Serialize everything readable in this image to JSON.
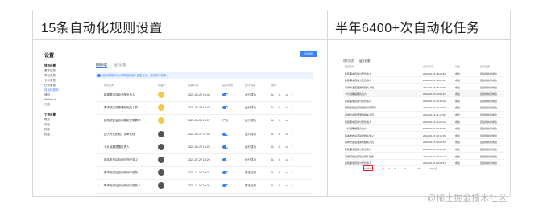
{
  "panels": [
    {
      "title": "15条自动化规则设置"
    },
    {
      "title": "半年6400+次自动化任务"
    }
  ],
  "settings": {
    "title": "设置",
    "create_button": "添加规则",
    "sidebar_groups": [
      {
        "label": "项目设置",
        "items": [
          "基本信息",
          "项目成员",
          "卡片类型",
          "任务看板",
          "自动化规则",
          "通知",
          "Webhook",
          "归档"
        ]
      },
      {
        "label": "工作设置",
        "items": [
          "概览",
          "字段",
          "标签",
          "权限"
        ]
      }
    ],
    "tabs": [
      "规则列表",
      "运行记录"
    ],
    "banner": "自动化规则可以帮助团队减少重复工作，提升协作效率。",
    "columns": [
      "规则名称",
      "创建人",
      "更新时间",
      "启用状态",
      "运行结果",
      "操作"
    ],
    "rules": [
      {
        "name": "新建需求自动分配负责人",
        "time": "2021-05-25 15:46",
        "enabled": true,
        "tag": "运行成功",
        "icon_color": "#f2c94c"
      },
      {
        "name": "需求状态变更通知相关人员",
        "time": "2021-05-25 15:46",
        "enabled": true,
        "tag": "运行成功",
        "icon_color": "#f2c94c"
      },
      {
        "name": "缺陷修复后自动更新关联需求",
        "time": "2021-05-31 16:07",
        "enabled": false,
        "tag": "运行成功",
        "icon_color": "#f2c94c"
      },
      {
        "name": "进入开发阶段，评审完成",
        "time": "2021-06-17 17:42",
        "enabled": true,
        "tag": "运行成功",
        "icon_color": "#555555"
      },
      {
        "name": "卡片延期提醒负责人",
        "time": "2021-06-22 15:28",
        "enabled": true,
        "tag": "运行成功",
        "icon_color": "#555555"
      },
      {
        "name": "版本发布后自动归档任务-2",
        "time": "2021-07-22 13:20",
        "enabled": true,
        "tag": "运行成功",
        "icon_color": "#555555"
      },
      {
        "name": "需求完成后自动关闭子任务",
        "time": "2021-11-29 10:07",
        "enabled": true,
        "tag": "暂无记录",
        "icon_color": "#555555"
      },
      {
        "name": "需求完成后自动关闭子任务-2",
        "time": "2021-11-29 10:08",
        "enabled": true,
        "tag": "暂无记录",
        "icon_color": "#555555"
      }
    ],
    "ops_glyphs": "⧉ ⚙ ⌫ ⋮"
  },
  "records": {
    "tabs": [
      "规则列表",
      "运行记录"
    ],
    "columns": [
      "规则名称",
      "运行时间",
      "状态",
      "运行结果"
    ],
    "rows": [
      {
        "name": "新建需求自动分配负责人",
        "time": "2022-06-15 16:03:42",
        "status": "成功",
        "result": "自动化执行成功"
      },
      {
        "name": "新建需求自动分配负责人",
        "time": "2022-06-15 16:02:11",
        "status": "成功",
        "result": "自动化执行成功"
      },
      {
        "name": "需求状态变更通知相关人员",
        "time": "2022-06-15 15:48:09",
        "status": "成功",
        "result": "自动化执行成功"
      },
      {
        "name": "卡片延期提醒负责人",
        "time": "2022-06-15 14:55:37",
        "status": "成功",
        "result": "自动化执行成功"
      },
      {
        "name": "新建需求自动分配负责人",
        "time": "2022-06-15 14:30:20",
        "status": "成功",
        "result": "自动化执行成功"
      },
      {
        "name": "缺陷修复后自动更新关联需求",
        "time": "2022-06-15 13:12:06",
        "status": "成功",
        "result": "自动化执行成功"
      },
      {
        "name": "需求状态变更通知相关人员",
        "time": "2022-06-15 11:47:52",
        "status": "成功",
        "result": "自动化执行成功"
      },
      {
        "name": "新建需求自动分配负责人",
        "time": "2022-06-15 11:20:14",
        "status": "成功",
        "result": "自动化执行成功"
      },
      {
        "name": "卡片延期提醒负责人",
        "time": "2022-06-15 10:58:40",
        "status": "成功",
        "result": "自动化执行成功"
      },
      {
        "name": "版本发布后自动归档任务-2",
        "time": "2022-06-15 10:31:05",
        "status": "成功",
        "result": "自动化执行成功"
      },
      {
        "name": "需求状态变更通知相关人员",
        "time": "2022-06-15 10:06:33",
        "status": "成功",
        "result": "自动化执行成功"
      },
      {
        "name": "新建需求自动分配负责人",
        "time": "2022-06-15 09:41:18",
        "status": "成功",
        "result": "自动化执行成功"
      },
      {
        "name": "需求完成后自动关闭子任务",
        "time": "2022-06-15 09:15:27",
        "status": "成功",
        "result": "自动化执行成功"
      },
      {
        "name": "新建需求自动分配负责人",
        "time": "2022-06-15 09:02:51",
        "status": "成功",
        "result": "自动化执行成功"
      }
    ],
    "pager": {
      "total": "共6435条",
      "pages": [
        "‹",
        "1",
        "2",
        "3",
        "4",
        "5",
        "…",
        "322",
        "›"
      ],
      "size": "20条/页"
    }
  },
  "watermark": "@稀土掘金技术社区"
}
